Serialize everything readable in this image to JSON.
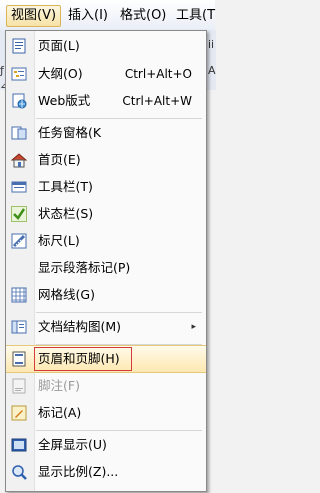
{
  "menubar": {
    "items": [
      {
        "label": "视图(V)",
        "active": true
      },
      {
        "label": "插入(I)",
        "active": false
      },
      {
        "label": "格式(O)",
        "active": false
      },
      {
        "label": "工具(T",
        "active": false
      }
    ]
  },
  "left_strip_glyphs": [
    "ƒ",
    "⊿"
  ],
  "right_strip_glyphs": [
    "ii",
    "A"
  ],
  "menu": {
    "items": [
      {
        "label": "页面(L)",
        "shortcut": "",
        "icon": "page-view-icon"
      },
      {
        "label": "大纲(O)",
        "shortcut": "Ctrl+Alt+O",
        "icon": "outline-icon"
      },
      {
        "label": "Web版式",
        "shortcut": "Ctrl+Alt+W",
        "icon": "web-layout-icon"
      },
      {
        "label": "任务窗格(K",
        "shortcut": "",
        "icon": "task-pane-icon"
      },
      {
        "label": "首页(E)",
        "shortcut": "",
        "icon": "home-icon"
      },
      {
        "label": "工具栏(T)",
        "shortcut": "",
        "icon": "toolbar-icon"
      },
      {
        "label": "状态栏(S)",
        "shortcut": "",
        "icon": "check-icon"
      },
      {
        "label": "标尺(L)",
        "shortcut": "",
        "icon": "ruler-icon"
      },
      {
        "label": "显示段落标记(P)",
        "shortcut": "",
        "icon": ""
      },
      {
        "label": "网格线(G)",
        "shortcut": "",
        "icon": "grid-icon"
      },
      {
        "label": "文档结构图(M)",
        "shortcut": "",
        "icon": "doc-map-icon",
        "submenu": "▸"
      },
      {
        "label": "页眉和页脚(H)",
        "shortcut": "",
        "icon": "header-footer-icon"
      },
      {
        "label": "脚注(F)",
        "shortcut": "",
        "icon": "footnote-icon",
        "disabled": true
      },
      {
        "label": "标记(A)",
        "shortcut": "",
        "icon": "markup-icon"
      },
      {
        "label": "全屏显示(U)",
        "shortcut": "",
        "icon": "fullscreen-icon"
      },
      {
        "label": "显示比例(Z)...",
        "shortcut": "",
        "icon": "zoom-icon"
      }
    ]
  }
}
